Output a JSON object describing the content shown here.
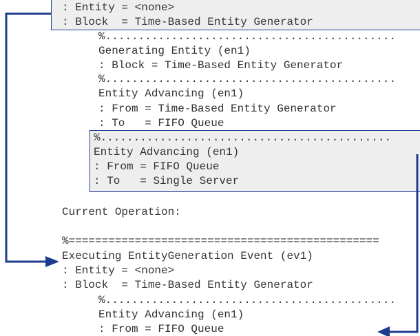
{
  "top_block": {
    "line1": ": Entity = <none>",
    "line2": ": Block  = Time-Based Entity Generator"
  },
  "log_entries": [
    {
      "sep": "%............................................",
      "title": "Generating Entity (en1)",
      "l1": ": Block = Time-Based Entity Generator",
      "l2": ""
    },
    {
      "sep": "%............................................",
      "title": "Entity Advancing (en1)",
      "l1": ": From = Time-Based Entity Generator",
      "l2": ": To   = FIFO Queue"
    },
    {
      "sep": "%............................................",
      "title": "Entity Advancing (en1)",
      "l1": ": From = FIFO Queue",
      "l2": ": To   = Single Server"
    }
  ],
  "current_operation": {
    "label": "Current Operation:",
    "separator": "%===============================================",
    "event_title": "Executing EntityGeneration Event (ev1)",
    "entity_line": ": Entity = <none>",
    "block_line": ": Block  = Time-Based Entity Generator"
  },
  "bottom_entry": {
    "sep": "%............................................",
    "title": "Entity Advancing (en1)",
    "from_line": ": From = FIFO Queue"
  },
  "colors": {
    "arrow": "#1c3d8f",
    "highlight_fill": "#eeeeee",
    "text": "#333333"
  }
}
